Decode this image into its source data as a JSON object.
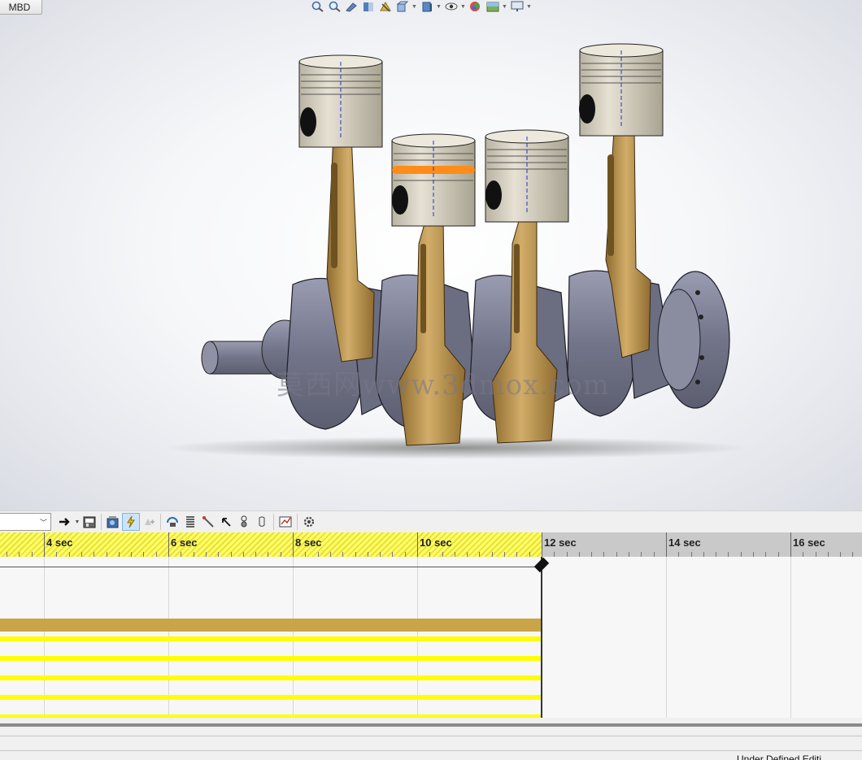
{
  "viewport": {
    "tab_label": "MBD",
    "watermark": "莫西网www.3dmox.com",
    "heads_up_icons": [
      "zoom-to-fit-icon",
      "zoom-to-area-icon",
      "previous-view-icon",
      "section-view-icon",
      "dynamic-annotation-icon",
      "view-orientation-icon",
      "display-style-icon",
      "hide-show-items-icon",
      "edit-appearance-icon",
      "apply-scene-icon",
      "view-settings-icon"
    ]
  },
  "motion_toolbar": {
    "study_type_value": "",
    "buttons": [
      "calculate-icon",
      "play-from-start-icon",
      "save-animation-icon",
      "animation-wizard-icon",
      "autokey-icon",
      "add-update-key-icon",
      "motor-icon",
      "spring-icon",
      "damper-icon",
      "force-icon",
      "contact-icon",
      "gravity-icon",
      "results-and-plots-icon",
      "motion-study-properties-icon"
    ]
  },
  "timeline": {
    "ruler_labels": [
      "4 sec",
      "6 sec",
      "8 sec",
      "10 sec",
      "12 sec",
      "14 sec",
      "16 sec"
    ],
    "current_time_sec": 12,
    "colors": {
      "hatch": "#ffff66",
      "main_track": "#c9a548",
      "value_track": "#ffff00"
    }
  },
  "status_bar": {
    "text": "Under Defined   Editi"
  },
  "colors": {
    "piston": "#d9d4c6",
    "connecting_rod": "#b8914f",
    "crankshaft": "#7e8096",
    "selected_ring": "#ff8c1a"
  }
}
